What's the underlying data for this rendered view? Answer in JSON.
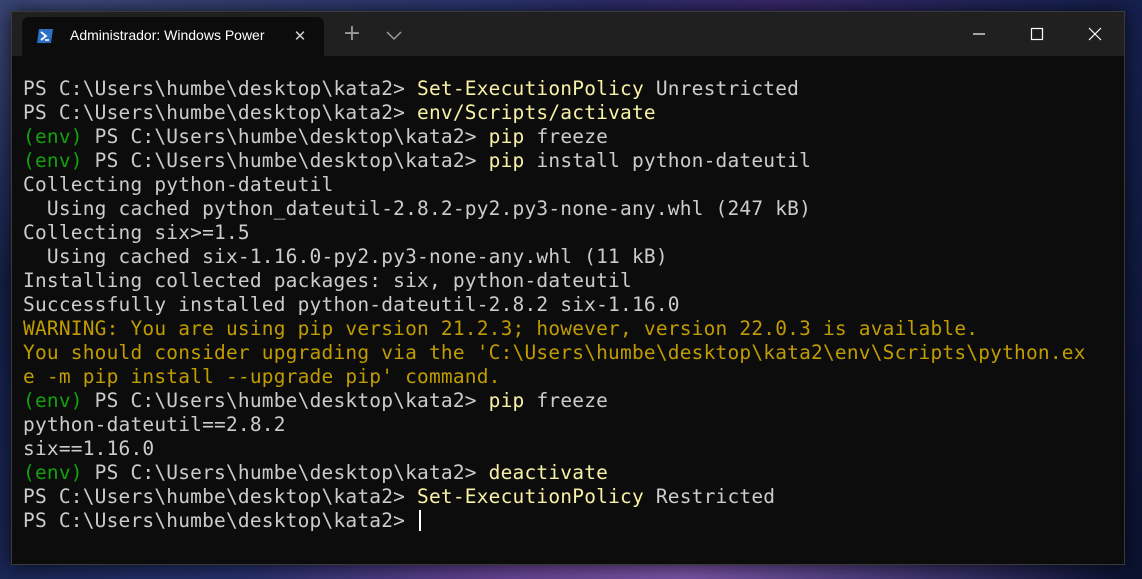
{
  "window": {
    "tab_title": "Administrador: Windows Power",
    "tab_icon": "powershell-icon",
    "close_tab_icon": "close-icon",
    "new_tab_glyph": "+",
    "colors": {
      "background": "#0c0c0c",
      "text": "#cccccc",
      "prompt_env": "#13a10e",
      "command": "#f9f1a5",
      "warning": "#c19c00"
    }
  },
  "terminal": {
    "lines": [
      {
        "segments": [
          {
            "text": "PS C:\\Users\\humbe\\desktop\\kata2> ",
            "cls": "def"
          },
          {
            "text": "Set-ExecutionPolicy",
            "cls": "yel"
          },
          {
            "text": " Unrestricted",
            "cls": "def"
          }
        ]
      },
      {
        "segments": [
          {
            "text": "PS C:\\Users\\humbe\\desktop\\kata2> ",
            "cls": "def"
          },
          {
            "text": "env/Scripts/activate",
            "cls": "yel"
          }
        ]
      },
      {
        "segments": [
          {
            "text": "(env)",
            "cls": "grn"
          },
          {
            "text": " PS C:\\Users\\humbe\\desktop\\kata2> ",
            "cls": "def"
          },
          {
            "text": "pip",
            "cls": "yel"
          },
          {
            "text": " freeze",
            "cls": "def"
          }
        ]
      },
      {
        "segments": [
          {
            "text": "(env)",
            "cls": "grn"
          },
          {
            "text": " PS C:\\Users\\humbe\\desktop\\kata2> ",
            "cls": "def"
          },
          {
            "text": "pip",
            "cls": "yel"
          },
          {
            "text": " install python-dateutil",
            "cls": "def"
          }
        ]
      },
      {
        "segments": [
          {
            "text": "Collecting python-dateutil",
            "cls": "def"
          }
        ]
      },
      {
        "segments": [
          {
            "text": "  Using cached python_dateutil-2.8.2-py2.py3-none-any.whl (247 kB)",
            "cls": "def"
          }
        ]
      },
      {
        "segments": [
          {
            "text": "Collecting six>=1.5",
            "cls": "def"
          }
        ]
      },
      {
        "segments": [
          {
            "text": "  Using cached six-1.16.0-py2.py3-none-any.whl (11 kB)",
            "cls": "def"
          }
        ]
      },
      {
        "segments": [
          {
            "text": "Installing collected packages: six, python-dateutil",
            "cls": "def"
          }
        ]
      },
      {
        "segments": [
          {
            "text": "Successfully installed python-dateutil-2.8.2 six-1.16.0",
            "cls": "def"
          }
        ]
      },
      {
        "segments": [
          {
            "text": "WARNING: You are using pip version 21.2.3; however, version 22.0.3 is available.",
            "cls": "warn"
          }
        ]
      },
      {
        "segments": [
          {
            "text": "You should consider upgrading via the 'C:\\Users\\humbe\\desktop\\kata2\\env\\Scripts\\python.ex",
            "cls": "warn"
          }
        ]
      },
      {
        "segments": [
          {
            "text": "e -m pip install --upgrade pip' command.",
            "cls": "warn"
          }
        ]
      },
      {
        "segments": [
          {
            "text": "(env)",
            "cls": "grn"
          },
          {
            "text": " PS C:\\Users\\humbe\\desktop\\kata2> ",
            "cls": "def"
          },
          {
            "text": "pip",
            "cls": "yel"
          },
          {
            "text": " freeze",
            "cls": "def"
          }
        ]
      },
      {
        "segments": [
          {
            "text": "python-dateutil==2.8.2",
            "cls": "def"
          }
        ]
      },
      {
        "segments": [
          {
            "text": "six==1.16.0",
            "cls": "def"
          }
        ]
      },
      {
        "segments": [
          {
            "text": "(env)",
            "cls": "grn"
          },
          {
            "text": " PS C:\\Users\\humbe\\desktop\\kata2> ",
            "cls": "def"
          },
          {
            "text": "deactivate",
            "cls": "yel"
          }
        ]
      },
      {
        "segments": [
          {
            "text": "PS C:\\Users\\humbe\\desktop\\kata2> ",
            "cls": "def"
          },
          {
            "text": "Set-ExecutionPolicy",
            "cls": "yel"
          },
          {
            "text": " Restricted",
            "cls": "def"
          }
        ]
      },
      {
        "segments": [
          {
            "text": "PS C:\\Users\\humbe\\desktop\\kata2> ",
            "cls": "def"
          }
        ],
        "cursor": true
      }
    ]
  }
}
